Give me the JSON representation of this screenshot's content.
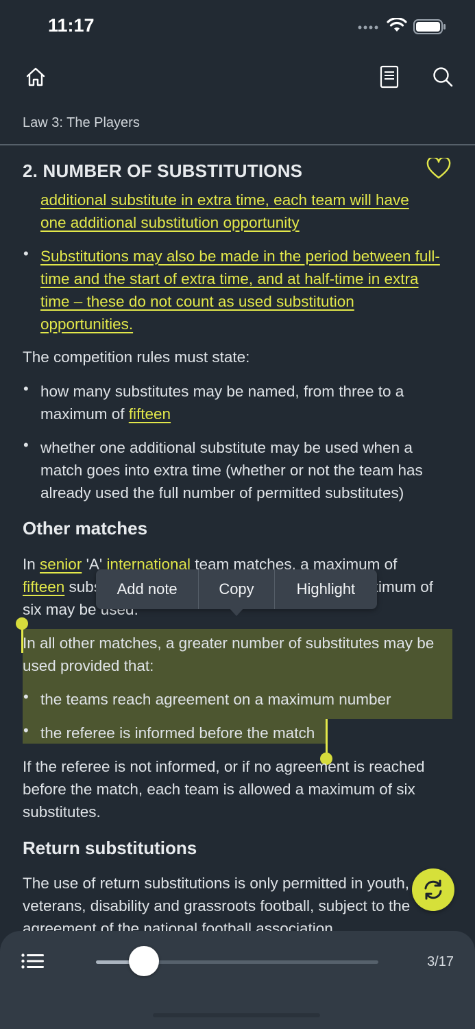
{
  "status": {
    "time": "11:17"
  },
  "header": {
    "breadcrumb": "Law 3: The Players"
  },
  "section": {
    "title": "2. NUMBER OF SUBSTITUTIONS",
    "frag_line1": "additional substitute in extra time, each team will have",
    "frag_line2": "one additional substitution opportunity",
    "bullet_a": "Substitutions may also be made in the period between full-time and the start of extra time, and at half-time in extra time – these do not count as used substitution opportunities.",
    "competition_rules": "The competition rules must state:",
    "b1_text": "how many substitutes may be named, from three to a maximum of ",
    "b1_link": "fifteen",
    "b2_text": "whether one additional substitute may be used when a match goes into extra time (whether or not the team has already used the full number of permitted substitutes)"
  },
  "other_matches": {
    "heading": "Other matches",
    "p1_a": "In ",
    "p1_link1": "senior",
    "p1_b": " 'A' ",
    "p1_link2": "international",
    "p1_c": " team matches, a maximum of",
    "p1_link3": "fifteen",
    "p1_d": " substitutes may be named, from which a maximum of",
    "p1_e": "six may be used.",
    "p2": "In all other matches, a greater number of substitutes may be used provided that:",
    "b1": "the teams reach agreement on a maximum number",
    "b2": "the referee is informed before the match",
    "p3": "If the referee is not informed, or if no agreement is reached before the match, each team is allowed a maximum of six substitutes."
  },
  "return_subs": {
    "heading": "Return substitutions",
    "p": "The use of return substitutions is only permitted in youth, veterans, disability and grassroots football, subject to the agreement of the national football association"
  },
  "popup": {
    "add_note": "Add note",
    "copy": "Copy",
    "highlight": "Highlight"
  },
  "bottom": {
    "page": "3/17",
    "progress": 0.17
  },
  "colors": {
    "accent": "#e3e84a",
    "background": "#222a33",
    "selection": "#4d5630"
  },
  "icons": [
    "home-icon",
    "book-icon",
    "search-icon",
    "heart-icon",
    "sync-icon",
    "list-icon"
  ]
}
